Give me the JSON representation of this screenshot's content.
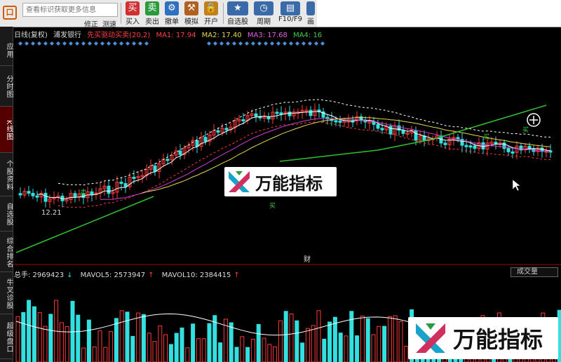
{
  "toolbar": {
    "search_placeholder": "查看标识获取更多信息",
    "sub_items": [
      "修正",
      "测速"
    ],
    "buttons": [
      {
        "glyph": "买",
        "label": "买入",
        "color": "#d03030"
      },
      {
        "glyph": "卖",
        "label": "卖出",
        "color": "#2a9a3a"
      },
      {
        "glyph": "⚙",
        "label": "撤单",
        "color": "#3070c0"
      },
      {
        "glyph": "⚒",
        "label": "模拟",
        "color": "#b06020"
      },
      {
        "glyph": "🔒",
        "label": "开户",
        "color": "#c08020"
      }
    ],
    "right_buttons": [
      {
        "glyph": "★",
        "label": "自选股"
      },
      {
        "glyph": "◷",
        "label": "周期"
      },
      {
        "glyph": "▤",
        "label": "F10/F9"
      },
      {
        "glyph": "画",
        "label": "画"
      }
    ]
  },
  "left_tabs": [
    {
      "label": "应用",
      "active": false
    },
    {
      "label": "分时图",
      "active": false
    },
    {
      "label": "K线图",
      "active": true
    },
    {
      "label": "个股资料",
      "active": false
    },
    {
      "label": "自选股",
      "active": false
    },
    {
      "label": "综合排名",
      "active": false
    },
    {
      "label": "牛叉诊股",
      "active": false
    },
    {
      "label": "超级盘口",
      "active": false
    }
  ],
  "chart_header": {
    "period": "日线(复权)",
    "stock": "浦发银行",
    "indicator": "先买驱动买卖(20,2)",
    "ma1": "MA1: 17.94",
    "ma2": "MA2: 17.40",
    "ma3": "MA3: 17.68",
    "ma4": "MA4: 16"
  },
  "chart_labels": {
    "low_price": "12.21",
    "cai": "财",
    "signal_texts": [
      "买",
      "买",
      "买",
      "买"
    ]
  },
  "volume_header": {
    "total": "总手: 2969423",
    "mavol5": "MAVOL5: 2573947",
    "mavol10": "MAVOL10: 2384415",
    "selector": "成交量"
  },
  "watermark": {
    "text": "万能指标"
  },
  "colors": {
    "up": "#ff3a3a",
    "down": "#33e0e0",
    "ma_white": "#ffffff",
    "ma_yellow": "#e8d850",
    "ma_magenta": "#d040d0",
    "ma_green": "#30c030",
    "info_red": "#ff4040",
    "info_yellow": "#e8d850",
    "info_magenta": "#e060e0",
    "info_green": "#40d040"
  }
}
